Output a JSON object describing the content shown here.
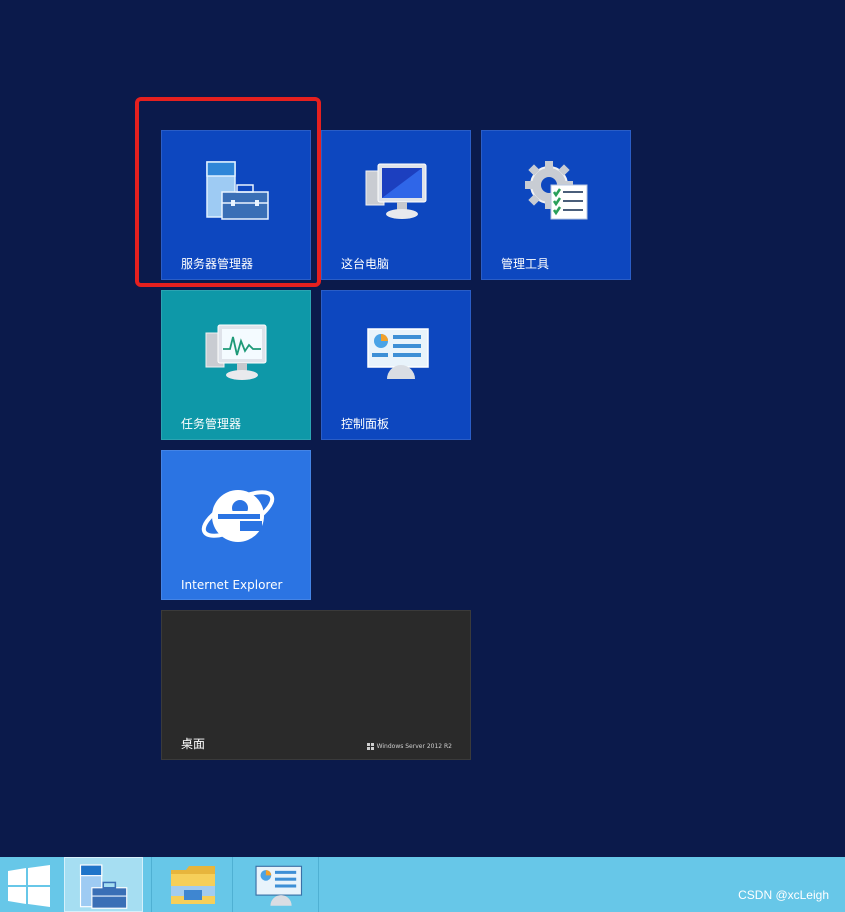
{
  "tiles": {
    "server_manager": "服务器管理器",
    "this_pc": "这台电脑",
    "admin_tools": "管理工具",
    "task_manager": "任务管理器",
    "control_panel": "控制面板",
    "ie": "Internet Explorer",
    "desktop": "桌面",
    "desktop_brand": "Windows Server 2012 R2"
  },
  "taskbar": {
    "watermark": "CSDN @xcLeigh"
  },
  "colors": {
    "background": "#0b1a4b",
    "tile_blue": "#0d47bf",
    "tile_teal": "#0e98a8",
    "tile_ie": "#2b74e3",
    "tile_desktop": "#2a2a2a",
    "highlight": "#e5201f",
    "taskbar": "#67c7e8"
  },
  "icons": [
    "server-manager-icon",
    "computer-icon",
    "admin-tools-gear-icon",
    "task-manager-icon",
    "control-panel-icon",
    "ie-logo-icon",
    "windows-logo-icon",
    "file-explorer-icon"
  ]
}
